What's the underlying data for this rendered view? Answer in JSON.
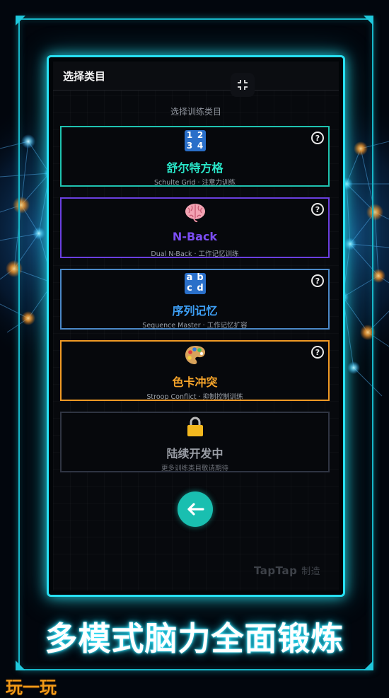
{
  "app": {
    "header_title": "选择类目",
    "subtitle": "选择训练类目"
  },
  "cards": [
    {
      "title": "舒尔特方格",
      "desc": "Schulte Grid · 注意力训练",
      "icon": "number-grid-icon",
      "border_color": "#1fc2b0",
      "title_color": "#29e6c9",
      "help_label": "?",
      "icon_digits": [
        "1",
        "2",
        "3",
        "4"
      ]
    },
    {
      "title": "N-Back",
      "desc": "Dual N-Back · 工作记忆训练",
      "icon": "brain-icon",
      "border_color": "#6a3fe0",
      "title_color": "#7b4df5",
      "help_label": "?"
    },
    {
      "title": "序列记忆",
      "desc": "Sequence Master · 工作记忆扩容",
      "icon": "abcd-letters-icon",
      "border_color": "#4b88c7",
      "title_color": "#3d9ff5",
      "help_label": "?",
      "icon_letters": [
        "a",
        "b",
        "c",
        "d"
      ]
    },
    {
      "title": "色卡冲突",
      "desc": "Stroop Conflict · 抑制控制训练",
      "icon": "palette-icon",
      "border_color": "#f09a25",
      "title_color": "#f7a52a",
      "help_label": "?"
    },
    {
      "title": "陆续开发中",
      "desc": "更多训练类目敬请期待",
      "icon": "lock-icon",
      "border_color": "#2f3442",
      "title_color": "#9a9ea6"
    }
  ],
  "back_button": {
    "icon": "arrow-left-icon",
    "color": "#19bfb0"
  },
  "exit_fullscreen": {
    "icon": "exit-fullscreen-icon"
  },
  "watermark": {
    "brand": "TapTap",
    "suffix": "制造"
  },
  "banner": {
    "text": "多模式脑力全面锻炼"
  },
  "corner_logo": {
    "text": "玩一玩"
  },
  "colors": {
    "frame": "#27e0f2",
    "background": "#02060d"
  }
}
